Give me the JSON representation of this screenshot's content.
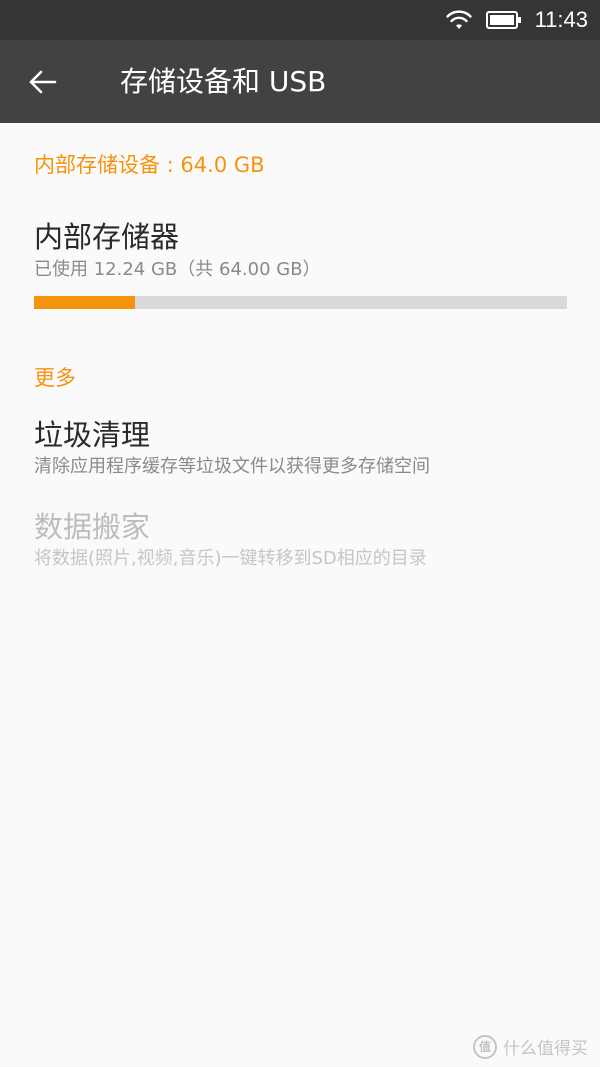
{
  "status_bar": {
    "time": "11:43",
    "icons": [
      "wifi-icon",
      "battery-icon"
    ]
  },
  "toolbar": {
    "back_icon": "arrow-back-icon",
    "title": "存储设备和 USB"
  },
  "internal": {
    "section_header": "内部存储设备 : 64.0 GB",
    "title": "内部存储器",
    "usage": "已使用 12.24 GB（共 64.00 GB）",
    "used_fraction": 0.19
  },
  "more": {
    "section_header": "更多",
    "items": [
      {
        "title": "垃圾清理",
        "subtitle": "清除应用程序缓存等垃圾文件以获得更多存储空间",
        "enabled": true
      },
      {
        "title": "数据搬家",
        "subtitle": "将数据(照片,视频,音乐)一键转移到SD相应的目录",
        "enabled": false
      }
    ]
  },
  "watermark": {
    "text": "什么值得买",
    "logo": "值"
  },
  "colors": {
    "accent": "#f5930d",
    "toolbar": "#424242",
    "status_bar": "#353535",
    "background": "#fafafa"
  }
}
